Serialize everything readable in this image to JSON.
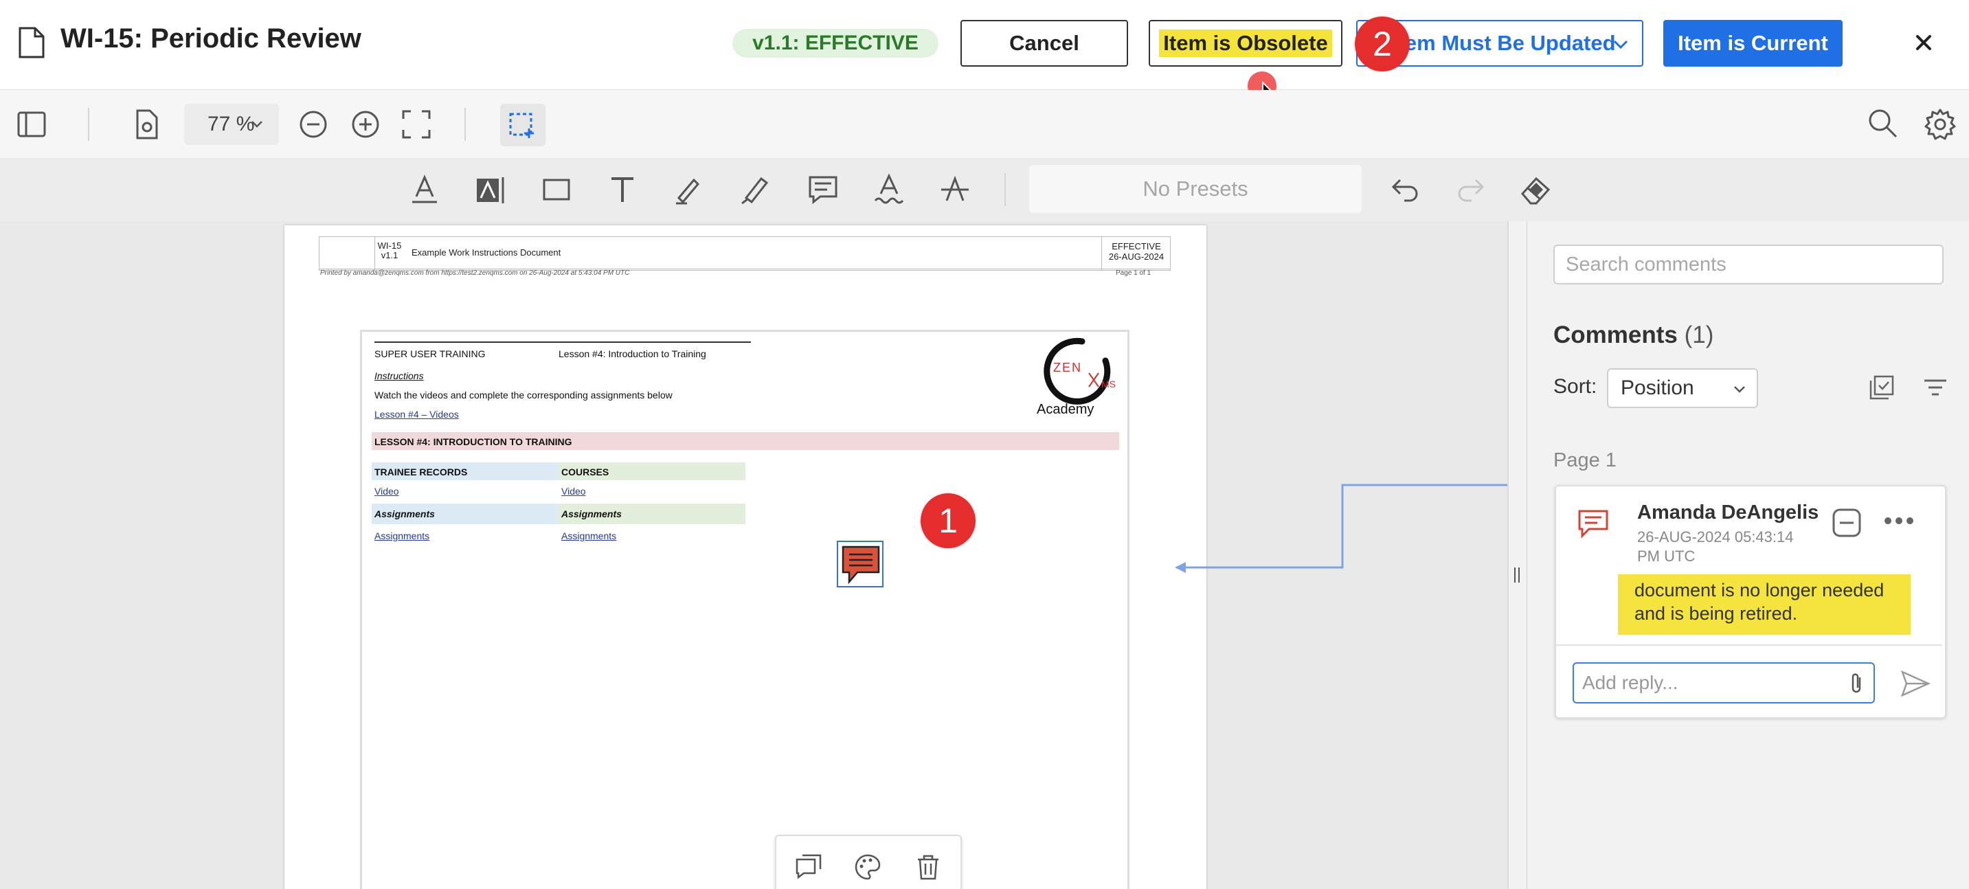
{
  "header": {
    "title": "WI-15: Periodic Review",
    "status": "v1.1: EFFECTIVE",
    "buttons": {
      "cancel": "Cancel",
      "obsolete": "Item is Obsolete",
      "must_update": "Item Must Be Updated",
      "current": "Item is Current"
    }
  },
  "steps": {
    "one": "1",
    "two": "2"
  },
  "toolbar": {
    "zoom": "77 %",
    "presets": "No Presets"
  },
  "document": {
    "header": {
      "doc_id": "WI-15",
      "version": "v1.1",
      "doc_title": "Example Work Instructions Document",
      "status": "EFFECTIVE",
      "date": "26-AUG-2024",
      "printed": "Printed by amanda@zenqms.com from https://test2.zenqms.com on 26-Aug-2024 at 5:43:04 PM UTC",
      "page": "Page 1 of 1"
    },
    "body": {
      "course": "SUPER USER TRAINING",
      "lesson": "Lesson #4: Introduction to Training",
      "instructions_label": "Instructions",
      "instructions_text": "Watch the videos and complete the corresponding assignments below",
      "videos_link": "Lesson #4 – Videos",
      "section_heading": "LESSON #4: INTRODUCTION TO TRAINING",
      "col1_heading": "TRAINEE RECORDS",
      "col2_heading": "COURSES",
      "video1": "Video",
      "video2": "Video",
      "assign_h1": "Assignments",
      "assign_h2": "Assignments",
      "assign_link1": "Assignments",
      "assign_link2": "Assignments",
      "logo_zen": "ZEN",
      "logo_ms": "MS",
      "logo_academy": "Academy"
    }
  },
  "comments": {
    "search_placeholder": "Search comments",
    "title": "Comments",
    "count": "(1)",
    "sort_label": "Sort:",
    "sort_value": "Position",
    "page_label": "Page 1",
    "items": [
      {
        "author": "Amanda DeAngelis",
        "time": "26-AUG-2024 05:43:14 PM UTC",
        "text": "document is no longer needed and is being retired."
      }
    ],
    "reply_placeholder": "Add reply..."
  },
  "colors": {
    "primary": "#1f6fe5",
    "highlight": "#f3e33a",
    "status_bg": "#e1f3df",
    "status_fg": "#2a7a2a",
    "step_badge": "#e52d2d",
    "comment_annotation": "#d9533a"
  },
  "icons": [
    "document-icon",
    "close-icon",
    "sidebar-toggle-icon",
    "doc-settings-icon",
    "zoom-out-icon",
    "zoom-in-icon",
    "fit-page-icon",
    "area-select-icon",
    "search-icon",
    "gear-icon",
    "underline-icon",
    "textbox-icon",
    "rectangle-icon",
    "text-icon",
    "pen-icon",
    "highlighter-icon",
    "comment-icon",
    "squiggly-icon",
    "strikeout-icon",
    "undo-icon",
    "redo-icon",
    "eraser-icon"
  ]
}
